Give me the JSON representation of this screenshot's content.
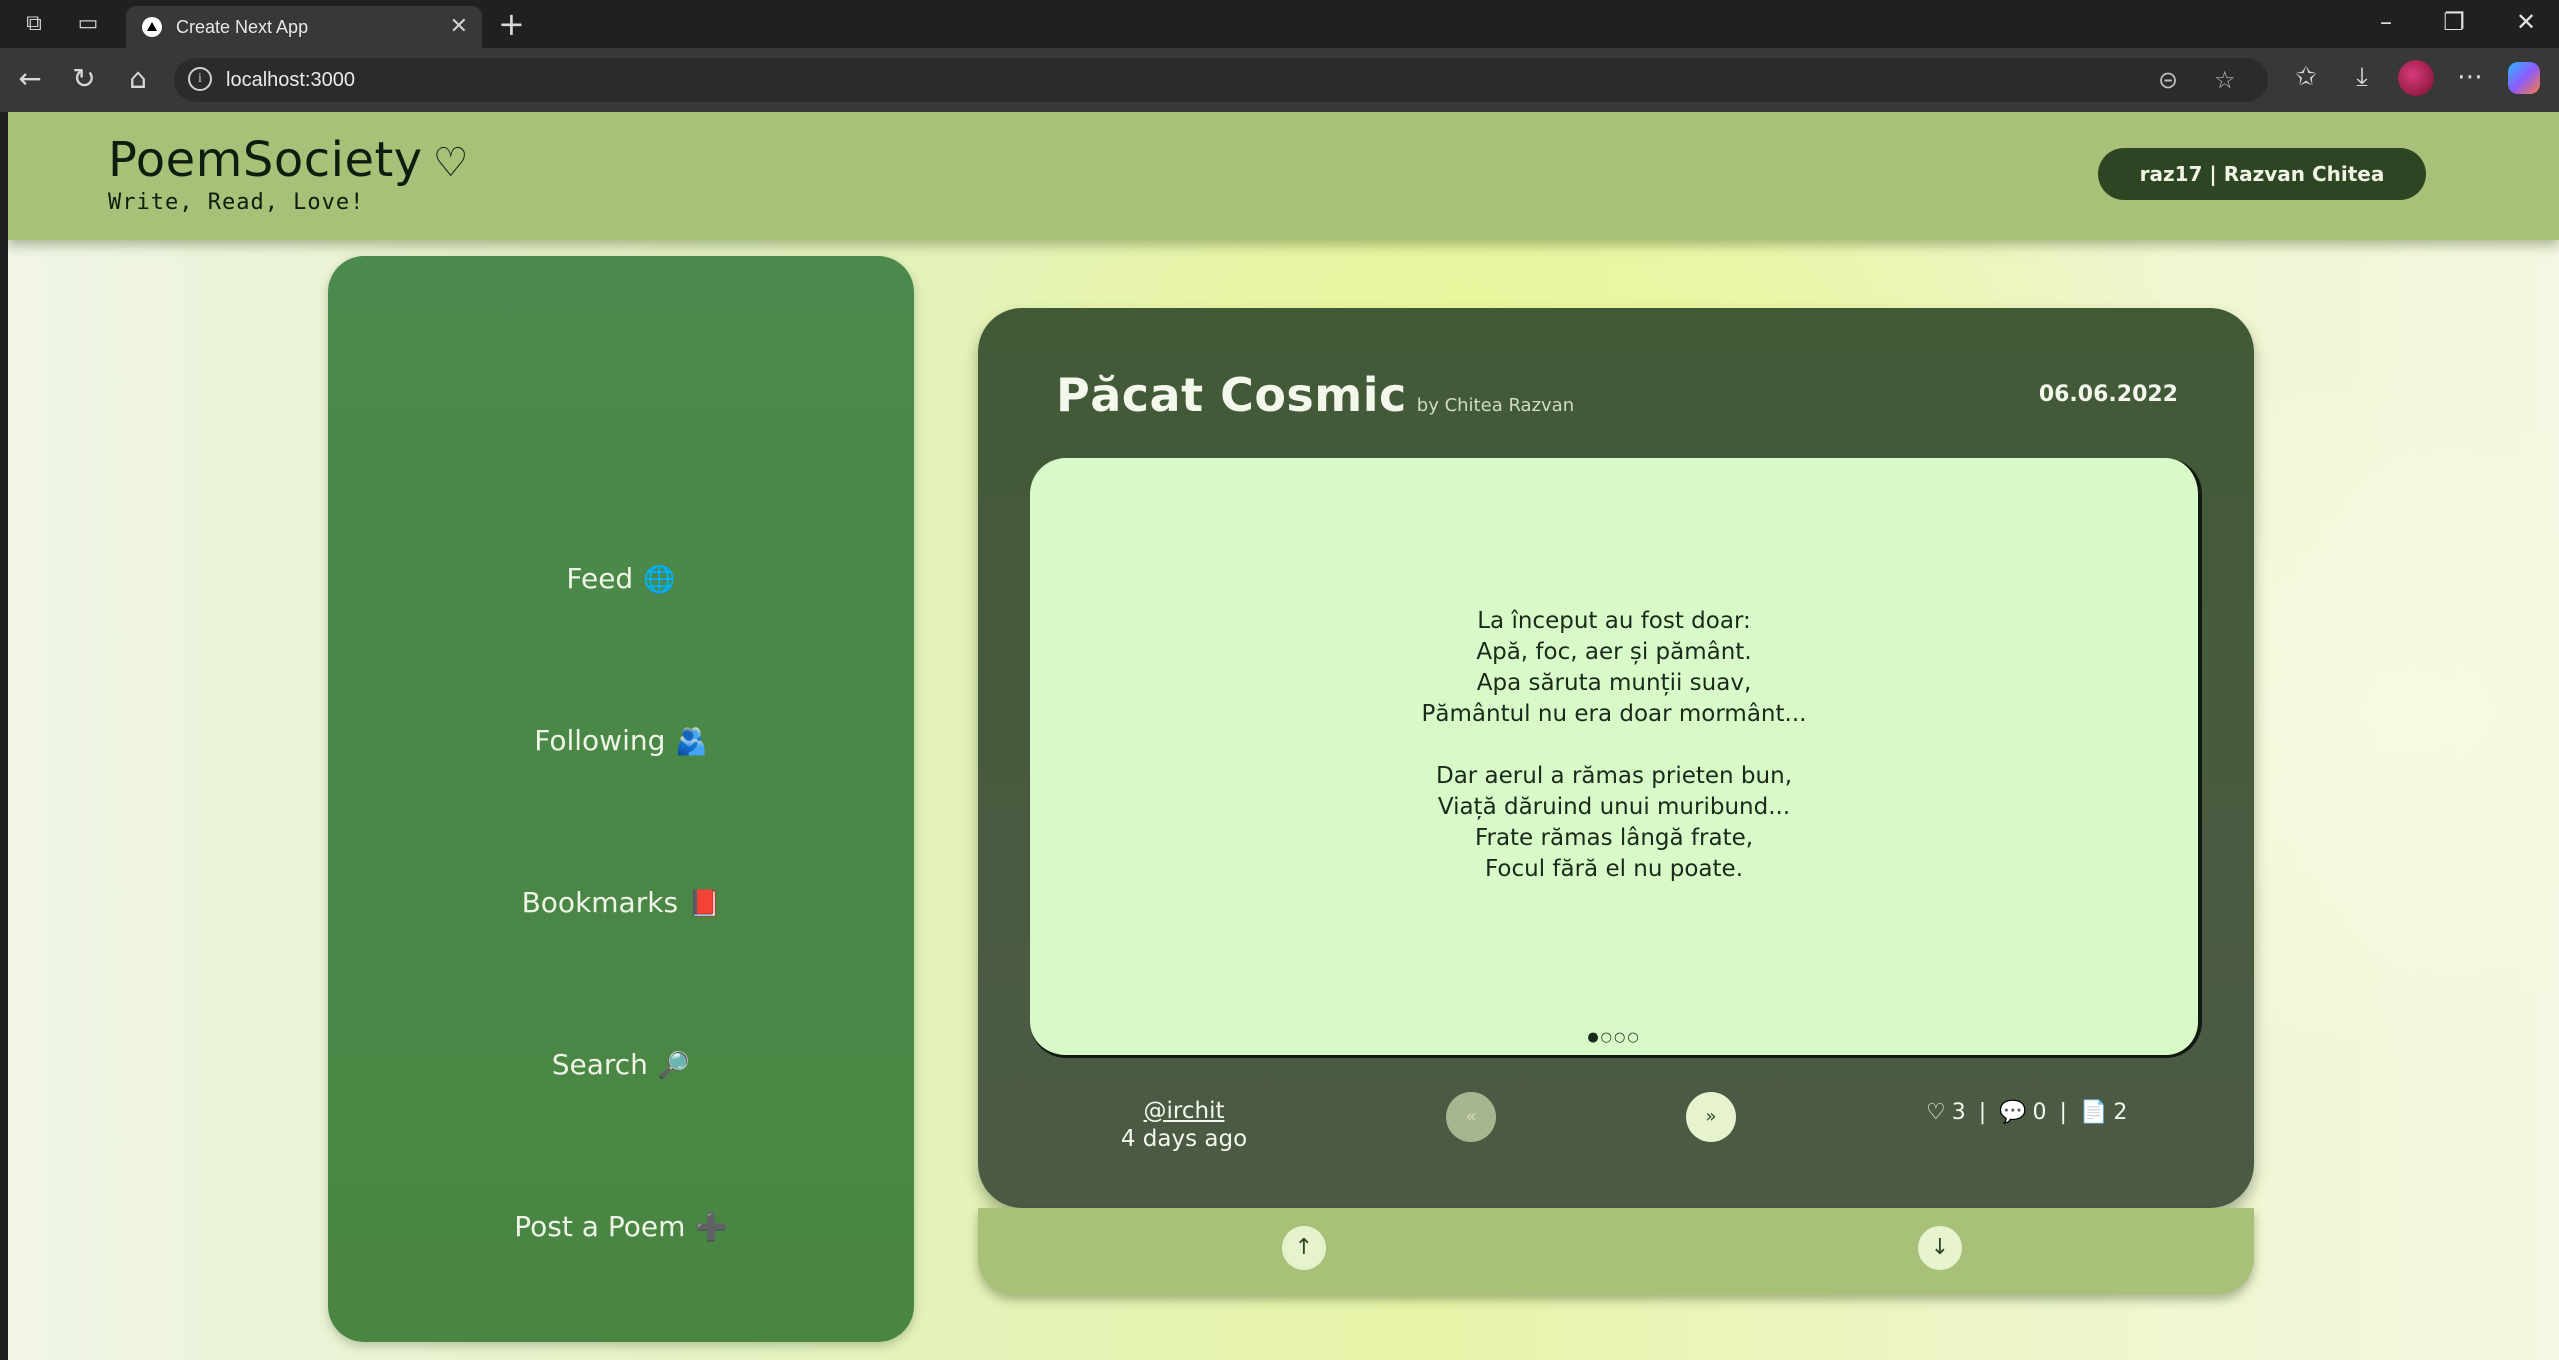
{
  "browser": {
    "tab_title": "Create Next App",
    "url": "localhost:3000"
  },
  "header": {
    "logo": "PoemSociety",
    "logo_heart": "♡",
    "tagline": "Write, Read, Love!",
    "user_button": "raz17 | Razvan Chitea"
  },
  "sidebar": {
    "items": [
      {
        "label": "Feed",
        "emoji": "🌐"
      },
      {
        "label": "Following",
        "emoji": "🫂"
      },
      {
        "label": "Bookmarks",
        "emoji": "📕"
      },
      {
        "label": "Search",
        "emoji": "🔎"
      },
      {
        "label": "Post a Poem",
        "emoji": "➕"
      }
    ]
  },
  "poem": {
    "title": "Păcat Cosmic",
    "author": "by Chitea Razvan",
    "date": "06.06.2022",
    "stanza1": [
      "La început au fost doar:",
      "Apă, foc, aer și pământ.",
      "Apa săruta munții suav,",
      "Pământul nu era doar mormânt..."
    ],
    "stanza2": [
      "Dar aerul a rămas prieten bun,",
      "Viață dăruind unui muribund...",
      "Frate rămas lângă frate,",
      "Focul fără el nu poate."
    ],
    "page_dots": "●○○○",
    "handle": "@irchit",
    "time_ago": "4 days ago",
    "prev_label": "«",
    "next_label": "»",
    "likes": "3",
    "comments": "0",
    "bookmarks": "2"
  },
  "votes": {
    "up": "↑",
    "down": "↓"
  },
  "colors": {
    "header": "#a8c078",
    "sidebar": "#4b8a4c",
    "card": "#405a36",
    "poem_box": "#d8fac8",
    "user_button": "#2e4523"
  }
}
